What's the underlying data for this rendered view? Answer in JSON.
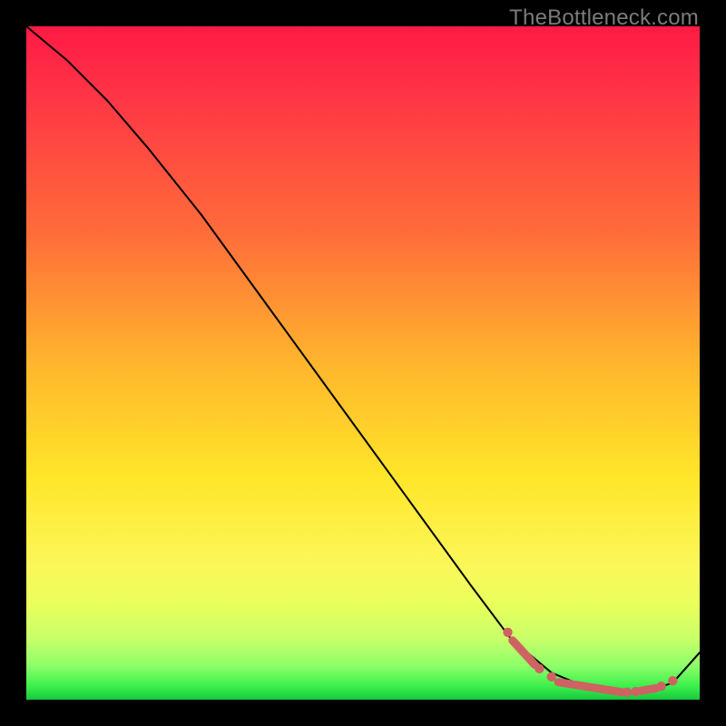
{
  "watermark": "TheBottleneck.com",
  "chart_data": {
    "type": "line",
    "title": "",
    "xlabel": "",
    "ylabel": "",
    "xlim": [
      0,
      100
    ],
    "ylim": [
      0,
      100
    ],
    "series": [
      {
        "name": "curve",
        "x": [
          0,
          6,
          12,
          18,
          26,
          34,
          42,
          50,
          58,
          66,
          72,
          78,
          84,
          88,
          92,
          96,
          100
        ],
        "values": [
          100,
          95,
          89,
          82,
          72,
          61,
          50,
          39,
          28,
          17,
          9,
          4,
          1.5,
          1.0,
          1.2,
          2.5,
          7
        ]
      }
    ],
    "markers": [
      {
        "kind": "dot",
        "x": 71.5,
        "y": 10.0
      },
      {
        "kind": "segment",
        "x1": 72.2,
        "y1": 8.8,
        "x2": 75.5,
        "y2": 5.2
      },
      {
        "kind": "dot",
        "x": 76.2,
        "y": 4.6
      },
      {
        "kind": "dot",
        "x": 78.0,
        "y": 3.4
      },
      {
        "kind": "segment",
        "x1": 79.0,
        "y1": 2.6,
        "x2": 88.5,
        "y2": 1.1
      },
      {
        "kind": "dot",
        "x": 89.2,
        "y": 1.1
      },
      {
        "kind": "dot",
        "x": 90.5,
        "y": 1.2
      },
      {
        "kind": "segment",
        "x1": 91.2,
        "y1": 1.3,
        "x2": 93.5,
        "y2": 1.7
      },
      {
        "kind": "dot",
        "x": 94.3,
        "y": 2.0
      },
      {
        "kind": "dot",
        "x": 96.0,
        "y": 2.8
      }
    ],
    "gradient_stops": [
      {
        "pos": 0.0,
        "color": "#ff1a44"
      },
      {
        "pos": 0.1,
        "color": "#ff3446"
      },
      {
        "pos": 0.3,
        "color": "#ff6a3a"
      },
      {
        "pos": 0.5,
        "color": "#ffb52d"
      },
      {
        "pos": 0.67,
        "color": "#ffe629"
      },
      {
        "pos": 0.8,
        "color": "#fbf75a"
      },
      {
        "pos": 0.86,
        "color": "#e8ff5c"
      },
      {
        "pos": 0.91,
        "color": "#c8ff6a"
      },
      {
        "pos": 0.95,
        "color": "#8cff68"
      },
      {
        "pos": 0.98,
        "color": "#3cf04c"
      },
      {
        "pos": 1.0,
        "color": "#16c83e"
      }
    ]
  }
}
